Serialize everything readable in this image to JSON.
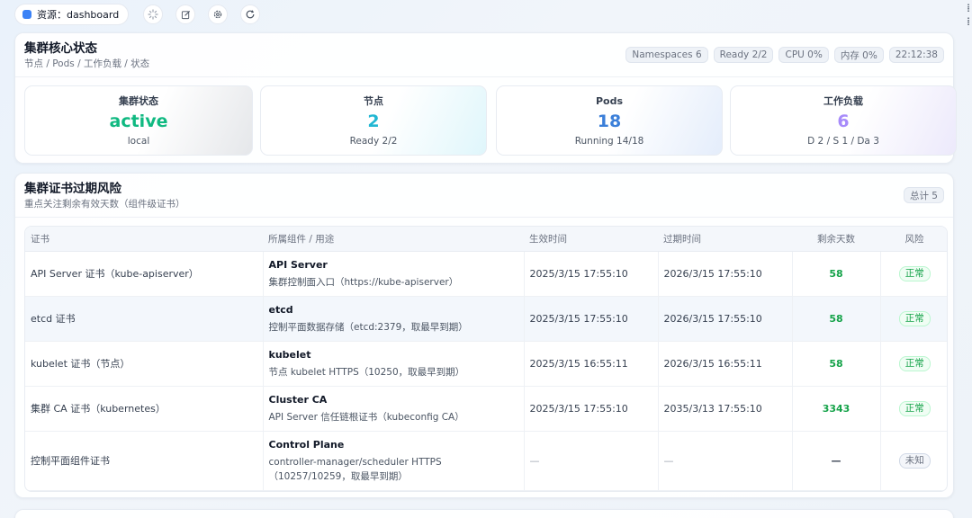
{
  "topbar": {
    "resource_label": "资源：dashboard",
    "icons": [
      "loading-icon",
      "edit-icon",
      "settings-icon",
      "refresh-icon"
    ]
  },
  "status_panel": {
    "title": "集群核心状态",
    "subtitle": "节点 / Pods / 工作负载 / 状态",
    "badges": [
      "Namespaces 6",
      "Ready 2/2",
      "CPU 0%",
      "内存 0%",
      "22:12:38"
    ],
    "cards": [
      {
        "label": "集群状态",
        "value": "active",
        "sub": "local",
        "color": "#10b981"
      },
      {
        "label": "节点",
        "value": "2",
        "sub": "Ready 2/2",
        "color": "#22b7d3"
      },
      {
        "label": "Pods",
        "value": "18",
        "sub": "Running 14/18",
        "color": "#3b7fd9"
      },
      {
        "label": "工作负载",
        "value": "6",
        "sub": "D 2 / S 1 / Da 3",
        "color": "#a78bfa"
      }
    ]
  },
  "cert_panel": {
    "title": "集群证书过期风险",
    "subtitle": "重点关注剩余有效天数（组件级证书）",
    "total_badge": "总计 5",
    "columns": [
      "证书",
      "所属组件 / 用途",
      "生效时间",
      "过期时间",
      "剩余天数",
      "风险"
    ],
    "rows": [
      {
        "cert": "API Server 证书（kube-apiserver）",
        "component": "API Server",
        "usage": "集群控制面入口（https://kube-apiserver）",
        "start": "2025/3/15 17:55:10",
        "expire": "2026/3/15 17:55:10",
        "days": "58",
        "risk": "正常"
      },
      {
        "cert": "etcd 证书",
        "component": "etcd",
        "usage": "控制平面数据存储（etcd:2379，取最早到期）",
        "start": "2025/3/15 17:55:10",
        "expire": "2026/3/15 17:55:10",
        "days": "58",
        "risk": "正常"
      },
      {
        "cert": "kubelet 证书（节点）",
        "component": "kubelet",
        "usage": "节点 kubelet HTTPS（10250，取最早到期）",
        "start": "2025/3/15 16:55:11",
        "expire": "2026/3/15 16:55:11",
        "days": "58",
        "risk": "正常"
      },
      {
        "cert": "集群 CA 证书（kubernetes）",
        "component": "Cluster CA",
        "usage": "API Server 信任链根证书（kubeconfig CA）",
        "start": "2025/3/15 17:55:10",
        "expire": "2035/3/13 17:55:10",
        "days": "3343",
        "risk": "正常"
      },
      {
        "cert": "控制平面组件证书",
        "component": "Control Plane",
        "usage": "controller-manager/scheduler HTTPS（10257/10259，取最早到期）",
        "start": "—",
        "expire": "—",
        "days": "—",
        "risk": "未知"
      }
    ]
  },
  "colors": {
    "ok": "#16a34a",
    "accent": "#3b82f6"
  }
}
